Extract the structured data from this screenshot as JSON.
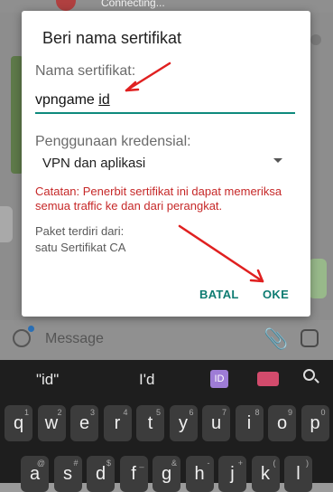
{
  "background": {
    "status_text": "Connecting...",
    "message_placeholder": "Message"
  },
  "dialog": {
    "title": "Beri nama sertifikat",
    "name_label": "Nama sertifikat:",
    "name_value_prefix": "vpngame ",
    "name_value_highlight": "id",
    "usage_label": "Penggunaan kredensial:",
    "usage_value": "VPN dan aplikasi",
    "warning": "Catatan: Penerbit sertifikat ini dapat memeriksa semua traffic ke dan dari perangkat.",
    "package_label": "Paket terdiri dari:",
    "package_value": "satu Sertifikat CA",
    "cancel_label": "BATAL",
    "ok_label": "OKE"
  },
  "keyboard": {
    "suggestions": [
      "\"id\"",
      "I'd"
    ],
    "suggestion_icon_text": "ID",
    "row1": [
      {
        "key": "q",
        "hint": "1"
      },
      {
        "key": "w",
        "hint": "2"
      },
      {
        "key": "e",
        "hint": "3"
      },
      {
        "key": "r",
        "hint": "4"
      },
      {
        "key": "t",
        "hint": "5"
      },
      {
        "key": "y",
        "hint": "6"
      },
      {
        "key": "u",
        "hint": "7"
      },
      {
        "key": "i",
        "hint": "8"
      },
      {
        "key": "o",
        "hint": "9"
      },
      {
        "key": "p",
        "hint": "0"
      }
    ],
    "row2": [
      {
        "key": "a",
        "hint": "@"
      },
      {
        "key": "s",
        "hint": "#"
      },
      {
        "key": "d",
        "hint": "$"
      },
      {
        "key": "f",
        "hint": "_"
      },
      {
        "key": "g",
        "hint": "&"
      },
      {
        "key": "h",
        "hint": "-"
      },
      {
        "key": "j",
        "hint": "+"
      },
      {
        "key": "k",
        "hint": "("
      },
      {
        "key": "l",
        "hint": ")"
      }
    ]
  },
  "annotation_color": "#e02020",
  "accent_color": "#0e8a7d"
}
